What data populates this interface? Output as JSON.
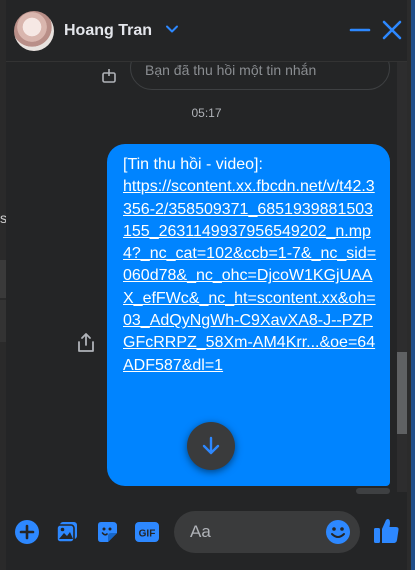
{
  "header": {
    "contact_name": "Hoang Tran",
    "icons": {
      "expand": "chevron-down-icon",
      "minimize": "minimize-icon",
      "close": "close-icon"
    }
  },
  "messages": {
    "previous_preview": "Bạn đã thu hồi một tin nhắn",
    "timestamp": "05:17",
    "bubble_prefix": "[Tin thu hồi - video]:",
    "bubble_link": "https://scontent.xx.fbcdn.net/v/t42.3356-2/358509371_6851939881503155_2631149937956549202_n.mp4?_nc_cat=102&ccb=1-7&_nc_sid=060d78&_nc_ohc=DjcoW1KGjUAAX_efFWc&_nc_ht=scontent.xx&oh=03_AdQyNgWh-C9XavXA8-J--PZPGFcRRPZ_58Xm-AM4Krr...&oe=64ADF587&dl=1"
  },
  "composer": {
    "placeholder": "Aa",
    "icons": [
      "plus-icon",
      "photo-icon",
      "sticker-icon",
      "gif-icon",
      "emoji-icon",
      "like-icon"
    ]
  },
  "colors": {
    "accent": "#0084ff",
    "background": "#242526",
    "text": "#e4e6eb"
  },
  "background_page": {
    "partial_char": "s"
  }
}
